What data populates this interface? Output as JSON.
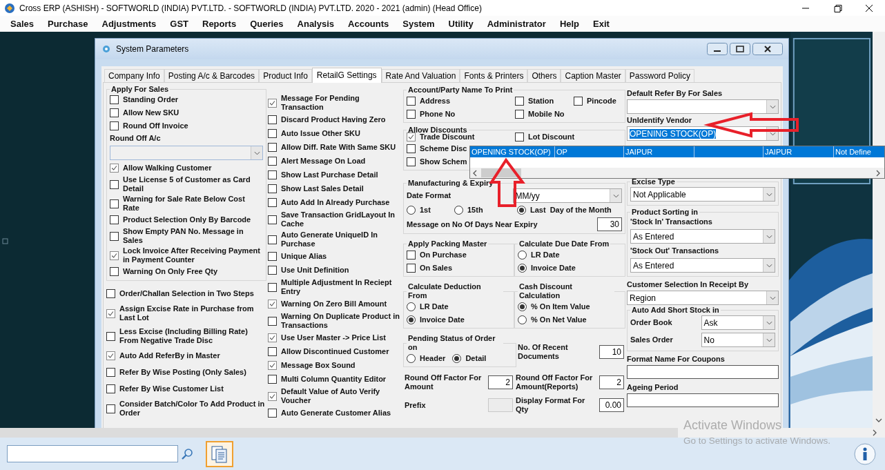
{
  "window": {
    "title": "Cross ERP (ASHISH) - SOFTWORLD (INDIA) PVT.LTD. - SOFTWORLD (INDIA) PVT.LTD.  2020 - 2021 (admin) (Head Office)"
  },
  "menu": [
    "Sales",
    "Purchase",
    "Adjustments",
    "GST",
    "Reports",
    "Queries",
    "Analysis",
    "Accounts",
    "System",
    "Utility",
    "Administrator",
    "Help",
    "Exit"
  ],
  "dialog": {
    "title": "System Parameters",
    "tabs": [
      {
        "label": "Company Info",
        "selected": false
      },
      {
        "label": "Posting A/c & Barcodes",
        "selected": false
      },
      {
        "label": "Product Info",
        "selected": false
      },
      {
        "label": "RetailG Settings",
        "selected": true
      },
      {
        "label": "Rate And Valuation",
        "selected": false
      },
      {
        "label": "Fonts & Printers",
        "selected": false
      },
      {
        "label": "Others",
        "selected": false
      },
      {
        "label": "Caption Master",
        "selected": false
      },
      {
        "label": "Password Policy",
        "selected": false
      }
    ],
    "columns": [
      {
        "blocks": [
          {
            "kind": "group",
            "title": "Apply For Sales",
            "items": [
              {
                "kind": "checkbox",
                "label": "Standing Order",
                "checked": false
              },
              {
                "kind": "checkbox",
                "label": "Allow New SKU",
                "checked": false
              },
              {
                "kind": "checkbox",
                "label": "Round Off Invoice",
                "checked": false
              },
              {
                "kind": "text",
                "label": "Round Off A/c"
              },
              {
                "kind": "combo",
                "disabled": true
              },
              {
                "kind": "checkbox",
                "label": "Allow Walking Customer",
                "checked": true
              },
              {
                "kind": "checkbox",
                "label": "Use License 5 of Customer as Card Detail",
                "checked": false
              },
              {
                "kind": "checkbox",
                "label": "Warning for Sale Rate Below Cost Rate",
                "checked": false
              },
              {
                "kind": "checkbox",
                "label": "Product Selection Only By Barcode",
                "checked": false
              },
              {
                "kind": "checkbox",
                "label": "Show Empty PAN No. Message in Sales",
                "checked": false
              },
              {
                "kind": "checkbox",
                "label": "Lock Invoice After Receiving Payment in Payment Counter",
                "checked": true
              },
              {
                "kind": "checkbox",
                "label": "Warning On Only Free Qty",
                "checked": false
              }
            ]
          },
          {
            "kind": "checkbox",
            "label": "Order/Challan Selection in Two Steps",
            "checked": false
          },
          {
            "kind": "checkbox",
            "label": "Assign Excise Rate in Purchase from Last Lot",
            "checked": true
          },
          {
            "kind": "checkbox",
            "label": "Less Excise (Including Billing Rate) From Negative Trade Disc",
            "checked": false
          },
          {
            "kind": "checkbox",
            "label": "Auto Add ReferBy in Master",
            "checked": true
          },
          {
            "kind": "checkbox",
            "label": "Refer By Wise Posting (Only Sales)",
            "checked": false
          },
          {
            "kind": "checkbox",
            "label": "Refer By Wise Customer List",
            "checked": false
          },
          {
            "kind": "checkbox",
            "label": "Consider Batch/Color To Add Product in Order",
            "checked": false
          }
        ]
      },
      {
        "blocks": [
          {
            "kind": "checkbox",
            "label": "Message For Pending Transaction",
            "checked": true
          },
          {
            "kind": "checkbox",
            "label": "Discard Product Having Zero",
            "checked": false
          },
          {
            "kind": "checkbox",
            "label": "Auto Issue Other SKU",
            "checked": false
          },
          {
            "kind": "checkbox",
            "label": "Allow Diff. Rate With Same SKU",
            "checked": false
          },
          {
            "kind": "checkbox",
            "label": "Alert Message On Load",
            "checked": false
          },
          {
            "kind": "checkbox",
            "label": "Show Last Purchase Detail",
            "checked": false
          },
          {
            "kind": "checkbox",
            "label": "Show Last Sales Detail",
            "checked": false
          },
          {
            "kind": "checkbox",
            "label": "Auto Add In Already Purchase",
            "checked": false
          },
          {
            "kind": "checkbox",
            "label": "Save Transaction GridLayout In Cache",
            "checked": false
          },
          {
            "kind": "checkbox",
            "label": "Auto Generate UniqueID In Purchase",
            "checked": false
          },
          {
            "kind": "checkbox",
            "label": "Unique Alias",
            "checked": false
          },
          {
            "kind": "checkbox",
            "label": "Use Unit Definition",
            "checked": false
          },
          {
            "kind": "checkbox",
            "label": "Multiple Adjustment In Reciept Entry",
            "checked": false
          },
          {
            "kind": "checkbox",
            "label": "Warning On Zero Bill Amount",
            "checked": true
          },
          {
            "kind": "checkbox",
            "label": "Warning On Duplicate Product in Transactions",
            "checked": false
          },
          {
            "kind": "checkbox",
            "label": "Use User Master -> Price List",
            "checked": true
          },
          {
            "kind": "checkbox",
            "label": "Allow Discontinued Customer",
            "checked": false
          },
          {
            "kind": "checkbox",
            "label": "Message Box Sound",
            "checked": true
          },
          {
            "kind": "checkbox",
            "label": "Multi Column Quantity Editor",
            "checked": false
          },
          {
            "kind": "checkbox",
            "label": "Default Value of Auto Verify Voucher",
            "checked": true
          },
          {
            "kind": "checkbox",
            "label": "Auto Generate Customer Alias",
            "checked": false
          }
        ]
      },
      {
        "blocks": [
          {
            "kind": "group",
            "title": "Account/Party Name To Print",
            "items": [
              {
                "kind": "row",
                "items": [
                  {
                    "kind": "checkbox",
                    "label": "Address",
                    "checked": false
                  },
                  {
                    "kind": "checkbox",
                    "label": "Station",
                    "checked": false
                  },
                  {
                    "kind": "checkbox",
                    "label": "Pincode",
                    "checked": false
                  }
                ]
              },
              {
                "kind": "row",
                "items": [
                  {
                    "kind": "checkbox",
                    "label": "Phone No",
                    "checked": false
                  },
                  {
                    "kind": "checkbox",
                    "label": "Mobile No",
                    "checked": false
                  }
                ]
              }
            ]
          },
          {
            "kind": "group",
            "title": "Allow Discounts",
            "items": [
              {
                "kind": "row",
                "items": [
                  {
                    "kind": "checkbox",
                    "label": "Trade Discount",
                    "checked": true
                  },
                  {
                    "kind": "checkbox",
                    "label": "Lot Discount",
                    "checked": false
                  }
                ]
              },
              {
                "kind": "checkbox",
                "label": "Scheme Disc",
                "checked": false
              },
              {
                "kind": "checkbox",
                "label": "Show Schem",
                "checked": false
              }
            ]
          },
          {
            "kind": "group",
            "title": "Manufacturing & Expiry",
            "items": [
              {
                "kind": "row",
                "items": [
                  {
                    "kind": "text",
                    "label": "Date Format"
                  },
                  {
                    "kind": "combo",
                    "value": "MM/yy"
                  }
                ]
              },
              {
                "kind": "row",
                "items": [
                  {
                    "kind": "radio",
                    "label": "1st",
                    "selected": false
                  },
                  {
                    "kind": "radio",
                    "label": "15th",
                    "selected": false
                  },
                  {
                    "kind": "radio",
                    "label": "Last",
                    "selected": true
                  },
                  {
                    "kind": "text",
                    "label": "Day of the Month"
                  }
                ]
              },
              {
                "kind": "row",
                "items": [
                  {
                    "kind": "text",
                    "label": "Message on No Of Days Near Expiry"
                  },
                  {
                    "kind": "input",
                    "value": "30"
                  }
                ]
              }
            ]
          },
          {
            "kind": "row",
            "items": [
              {
                "kind": "group",
                "title": "Apply Packing Master",
                "items": [
                  {
                    "kind": "checkbox",
                    "label": "On Purchase",
                    "checked": false
                  },
                  {
                    "kind": "checkbox",
                    "label": "On Sales",
                    "checked": false
                  }
                ]
              },
              {
                "kind": "group",
                "title": "Calculate Due Date From",
                "items": [
                  {
                    "kind": "radio",
                    "label": "LR Date",
                    "selected": false
                  },
                  {
                    "kind": "radio",
                    "label": "Invoice Date",
                    "selected": true
                  }
                ]
              }
            ]
          },
          {
            "kind": "row",
            "items": [
              {
                "kind": "group",
                "title": "Calculate Deduction From",
                "items": [
                  {
                    "kind": "radio",
                    "label": "LR Date",
                    "selected": false
                  },
                  {
                    "kind": "radio",
                    "label": "Invoice Date",
                    "selected": true
                  }
                ]
              },
              {
                "kind": "group",
                "title": "Cash Discount Calculation",
                "items": [
                  {
                    "kind": "radio",
                    "label": "% On Item Value",
                    "selected": true
                  },
                  {
                    "kind": "radio",
                    "label": "% On Net Value",
                    "selected": false
                  }
                ]
              }
            ]
          },
          {
            "kind": "row",
            "items": [
              {
                "kind": "group",
                "title": "Pending Status of Order on",
                "items": [
                  {
                    "kind": "row",
                    "items": [
                      {
                        "kind": "radio",
                        "label": "Header",
                        "selected": false
                      },
                      {
                        "kind": "radio",
                        "label": "Detail",
                        "selected": true
                      }
                    ]
                  }
                ]
              },
              {
                "kind": "row",
                "items": [
                  {
                    "kind": "text",
                    "label": "No. Of Recent Documents"
                  },
                  {
                    "kind": "input",
                    "value": "10"
                  }
                ]
              }
            ]
          },
          {
            "kind": "row",
            "items": [
              {
                "kind": "row",
                "items": [
                  {
                    "kind": "text",
                    "label": "Round Off Factor For Amount"
                  },
                  {
                    "kind": "input",
                    "value": "2"
                  }
                ]
              },
              {
                "kind": "row",
                "items": [
                  {
                    "kind": "text",
                    "label": "Round Off Factor For Amount(Reports)"
                  },
                  {
                    "kind": "input",
                    "value": "2"
                  }
                ]
              }
            ]
          },
          {
            "kind": "row",
            "items": [
              {
                "kind": "row",
                "items": [
                  {
                    "kind": "text",
                    "label": "Prefix"
                  },
                  {
                    "kind": "input",
                    "disabled": true
                  }
                ]
              },
              {
                "kind": "row",
                "items": [
                  {
                    "kind": "text",
                    "label": "Display Format For Qty"
                  },
                  {
                    "kind": "input",
                    "value": "0.00"
                  }
                ]
              }
            ]
          }
        ]
      },
      {
        "blocks": [
          {
            "kind": "text",
            "label": "Default Refer By For Sales"
          },
          {
            "kind": "combo"
          },
          {
            "kind": "text",
            "label": "UnIdentify Vendor"
          },
          {
            "kind": "combo",
            "value": "OPENING STOCK(OP)",
            "highlighted": true
          },
          {
            "kind": "group",
            "title": "Excise Type",
            "items": [
              {
                "kind": "combo",
                "value": "Not Applicable"
              }
            ]
          },
          {
            "kind": "group",
            "title": "Product Sorting in",
            "items": [
              {
                "kind": "text",
                "label": "'Stock In' Transactions"
              },
              {
                "kind": "combo",
                "value": "As Entered"
              },
              {
                "kind": "text",
                "label": "'Stock Out' Transactions"
              },
              {
                "kind": "combo",
                "value": "As Entered"
              }
            ]
          },
          {
            "kind": "text",
            "label": "Customer Selection In Receipt By"
          },
          {
            "kind": "combo",
            "value": "Region"
          },
          {
            "kind": "group",
            "title": "Auto Add Short Stock in",
            "items": [
              {
                "kind": "row",
                "items": [
                  {
                    "kind": "text",
                    "label": "Order Book"
                  },
                  {
                    "kind": "combo",
                    "value": "Ask"
                  }
                ]
              },
              {
                "kind": "row",
                "items": [
                  {
                    "kind": "text",
                    "label": "Sales Order"
                  },
                  {
                    "kind": "combo",
                    "value": "No"
                  }
                ]
              }
            ]
          },
          {
            "kind": "text",
            "label": "Format Name For Coupons"
          },
          {
            "kind": "input"
          },
          {
            "kind": "text",
            "label": "Ageing Period"
          },
          {
            "kind": "input"
          }
        ]
      }
    ]
  },
  "vendor_list": {
    "rows": [
      {
        "selected": true,
        "cells": {
          "column_1": "OPENING STOCK(OP)",
          "column_2": "OP",
          "column_3": "JAIPUR",
          "column_5": "JAIPUR",
          "column_6": "Not Define"
        }
      }
    ]
  },
  "os_notice": {
    "title": "Activate Windows",
    "message": "Go to Settings to activate Windows."
  }
}
